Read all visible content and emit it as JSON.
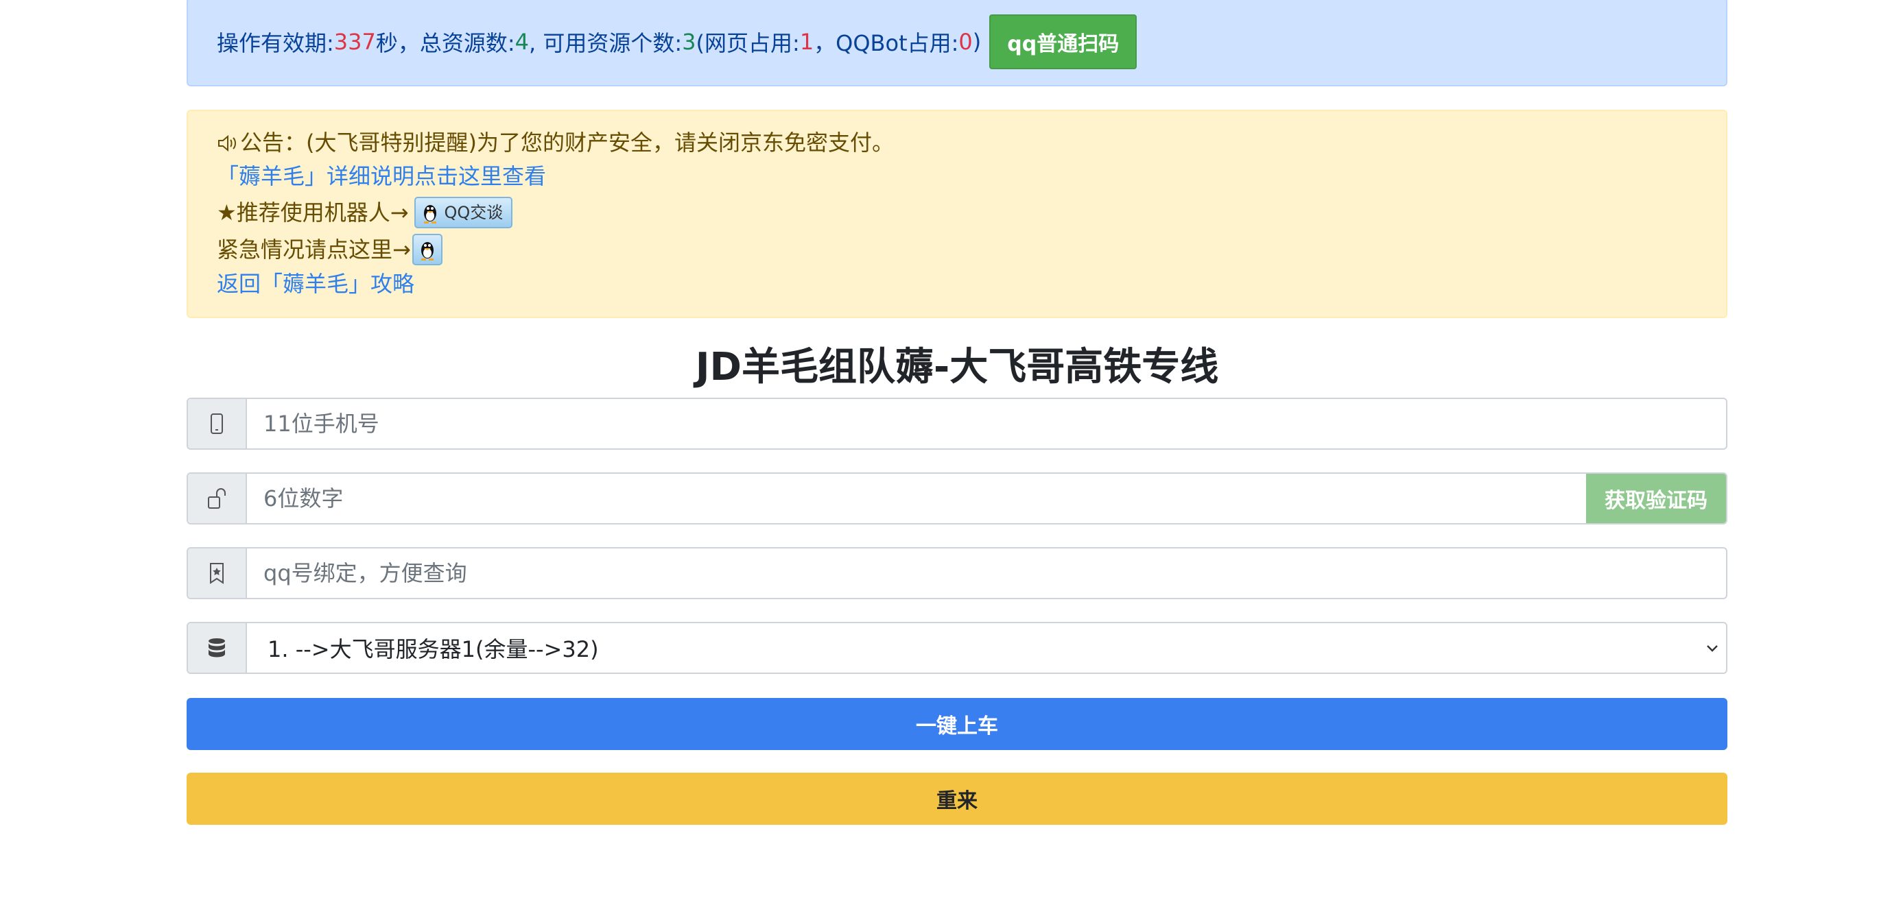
{
  "status": {
    "prefix": "操作有效期:",
    "seconds": "337",
    "sec_unit": "秒，总资源数:",
    "total": "4",
    "avail_label": ", 可用资源个数:",
    "available": "3",
    "web_label": "(网页占用:",
    "web": "1",
    "bot_label": "，QQBot占用:",
    "bot": "0",
    "close": ")",
    "scan_button": "qq普通扫码"
  },
  "notice": {
    "announcement": "公告：(大飞哥特别提醒)为了您的财产安全，请关闭京东免密支付。",
    "detail_link": "「薅羊毛」详细说明点击这里查看",
    "robot_text": "★推荐使用机器人→",
    "qq_chat": "QQ交谈",
    "emergency_text": "紧急情况请点这里→",
    "back_link": "返回「薅羊毛」攻略"
  },
  "page_title": "JD羊毛组队薅-大飞哥高铁专线",
  "form": {
    "phone_placeholder": "11位手机号",
    "code_placeholder": "6位数字",
    "get_code_button": "获取验证码",
    "qq_placeholder": "qq号绑定，方便查询",
    "server_selected": "1. -->大飞哥服务器1(余量-->32)",
    "submit_button": "一键上车",
    "reset_button": "重来"
  },
  "icons": {
    "phone": "phone-icon",
    "lock": "unlock-icon",
    "bookmark": "bookmark-star-icon",
    "database": "database-icon",
    "speaker": "speaker-icon",
    "qq": "qq-penguin-icon"
  },
  "colors": {
    "status_bg": "#cfe2ff",
    "notice_bg": "#fff3cd",
    "primary": "#3a7ff0",
    "warning": "#f5c342",
    "success": "#4cae4c"
  }
}
